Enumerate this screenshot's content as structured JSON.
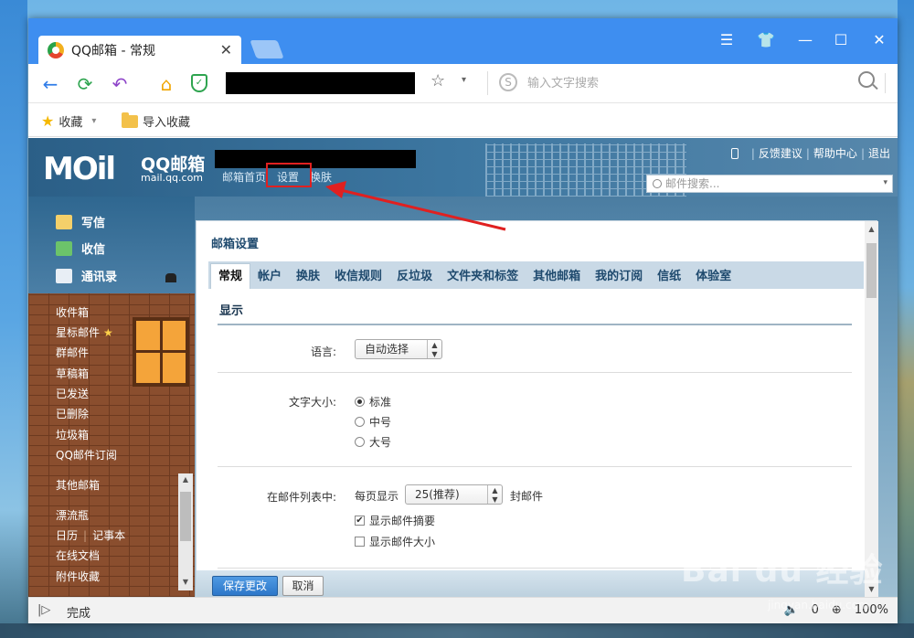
{
  "browser": {
    "tab_title": "QQ邮箱 - 常规",
    "tab_close": "✕",
    "window_controls": {
      "menu": "☰",
      "skin": "👕",
      "minimize": "—",
      "maximize": "☐",
      "close": "✕"
    },
    "nav": {
      "back": "←",
      "refresh": "⟳",
      "undo": "↶",
      "home": "⌂"
    },
    "shield_icon": "shield-icon",
    "favorite_star": "☆",
    "star_drop": "▾",
    "search_engine_glyph": "S",
    "search_placeholder": "输入文字搜索"
  },
  "bookmarks": {
    "favorites": "收藏",
    "favorites_drop": "▾",
    "import": "导入收藏"
  },
  "mail": {
    "logo_main": "MOil",
    "logo_name": "QQ邮箱",
    "logo_url": "mail.qq.com",
    "top_nav": [
      "邮箱首页",
      "设置",
      "换肤"
    ],
    "top_links": [
      "反馈建议",
      "帮助中心",
      "退出"
    ],
    "link_separator": "|",
    "search_placeholder": "邮件搜索...",
    "search_drop": "▾",
    "actions": {
      "compose": "写信",
      "inbox": "收信",
      "contacts": "通讯录"
    },
    "folders": {
      "inbox": "收件箱",
      "starred": "星标邮件",
      "star_mark": "★",
      "groups": "群邮件",
      "drafts": "草稿箱",
      "sent": "已发送",
      "deleted": "已删除",
      "spam": "垃圾箱",
      "subscriptions": "QQ邮件订阅",
      "other_mail": "其他邮箱",
      "bottle": "漂流瓶",
      "calendar": "日历",
      "divider": "|",
      "notes": "记事本",
      "docs": "在线文档",
      "attachments": "附件收藏"
    },
    "scroll_up": "▲",
    "scroll_down": "▼"
  },
  "settings": {
    "title": "邮箱设置",
    "tabs": [
      "常规",
      "帐户",
      "换肤",
      "收信规则",
      "反垃圾",
      "文件夹和标签",
      "其他邮箱",
      "我的订阅",
      "信纸",
      "体验室"
    ],
    "active_tab": "常规",
    "section_title": "显示",
    "language": {
      "label": "语言:",
      "value": "自动选择",
      "arrows": "▲▼"
    },
    "font_size": {
      "label": "文字大小:",
      "options": [
        "标准",
        "中号",
        "大号"
      ],
      "selected": "标准"
    },
    "list": {
      "label": "在邮件列表中:",
      "per_page_prefix": "每页显示",
      "per_page_value": "25(推荐)",
      "per_page_suffix": "封邮件",
      "show_summary": "显示邮件摘要",
      "show_summary_checked": true,
      "show_size": "显示邮件大小",
      "show_size_checked": false,
      "check_mark": "✔"
    },
    "save_button": "保存更改",
    "cancel_button": "取消"
  },
  "statusbar": {
    "left_icon": "|▷",
    "status": "完成",
    "badge_count": "0",
    "zoom": "100%",
    "speaker": "🔈",
    "zoom_icon": "⊕"
  },
  "watermark": {
    "brand": "Bai du 经验",
    "url": "jingyan.baidu.com"
  },
  "colors": {
    "browser_blue": "#3e8ef0",
    "highlight_red": "#e02020",
    "primary_button": "#2d77c9"
  }
}
